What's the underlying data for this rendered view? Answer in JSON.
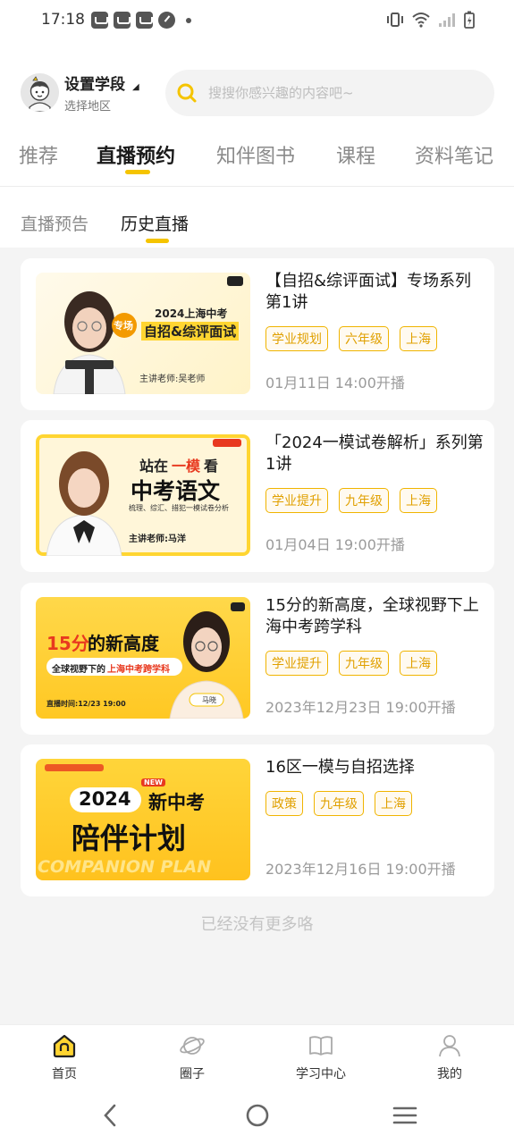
{
  "status_bar": {
    "time": "17:18"
  },
  "header": {
    "grade_title": "设置学段",
    "region": "选择地区",
    "search_placeholder": "搜搜你感兴趣的内容吧~"
  },
  "main_tabs": [
    {
      "label": "推荐",
      "active": false
    },
    {
      "label": "直播预约",
      "active": true
    },
    {
      "label": "知伴图书",
      "active": false
    },
    {
      "label": "课程",
      "active": false
    },
    {
      "label": "资料笔记",
      "active": false
    }
  ],
  "sub_tabs": [
    {
      "label": "直播预告",
      "active": false
    },
    {
      "label": "历史直播",
      "active": true
    }
  ],
  "lives": [
    {
      "title": "【自招&综评面试】专场系列第1讲",
      "tags": [
        "学业规划",
        "六年级",
        "上海"
      ],
      "time": "01月11日 14:00开播",
      "thumb": {
        "line1": "2024上海中考",
        "badge": "专场",
        "line2": "自招&综评面试",
        "teacher": "主讲老师:吴老师"
      }
    },
    {
      "title": "「2024一模试卷解析」系列第1讲",
      "tags": [
        "学业提升",
        "九年级",
        "上海"
      ],
      "time": "01月04日 19:00开播",
      "thumb": {
        "line1a": "站在",
        "line1b": "一模",
        "line1c": "看",
        "line2": "中考语文",
        "line3": "梳理、综汇、措犯一模试卷分析",
        "teacher": "主讲老师:马洋"
      }
    },
    {
      "title": "15分的新高度，全球视野下上海中考跨学科",
      "tags": [
        "学业提升",
        "九年级",
        "上海"
      ],
      "time": "2023年12月23日 19:00开播",
      "thumb": {
        "line1a": "15分",
        "line1b": "的新高度",
        "line2a": "全球视野下的",
        "line2b": "上海中考跨学科",
        "date": "直播时间:12/23  19:00",
        "name": "马晓"
      }
    },
    {
      "title": "16区一模与自招选择",
      "tags": [
        "政策",
        "九年级",
        "上海"
      ],
      "time": "2023年12月16日 19:00开播",
      "thumb": {
        "new": "NEW",
        "year": "2024",
        "line1": "新中考",
        "line2": "陪伴计划",
        "watermark": "COMPANION PLAN"
      }
    }
  ],
  "footer_text": "已经没有更多咯",
  "bottom_nav": [
    {
      "label": "首页",
      "icon": "home-icon",
      "active": true
    },
    {
      "label": "圈子",
      "icon": "planet-icon",
      "active": false
    },
    {
      "label": "学习中心",
      "icon": "book-icon",
      "active": false
    },
    {
      "label": "我的",
      "icon": "user-icon",
      "active": false
    }
  ],
  "colors": {
    "accent": "#f5c400",
    "tag": "#e0a000",
    "background": "#f4f4f4"
  }
}
